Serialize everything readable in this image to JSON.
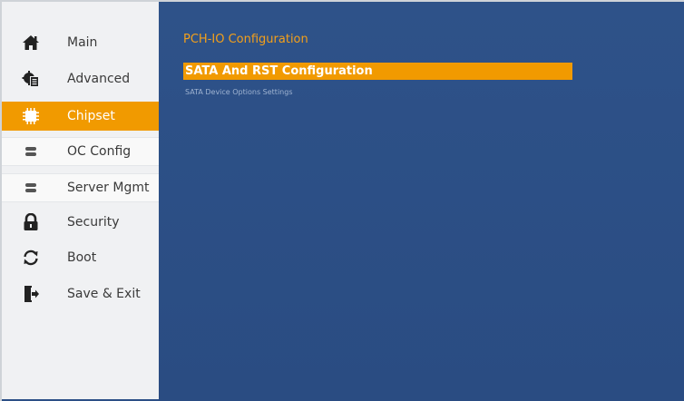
{
  "sidebar": {
    "items": [
      {
        "label": "Main",
        "icon": "home-icon"
      },
      {
        "label": "Advanced",
        "icon": "gear-clipboard-icon"
      },
      {
        "label": "Chipset",
        "icon": "chip-icon"
      },
      {
        "label": "OC Config",
        "icon": "server-icon"
      },
      {
        "label": "Server Mgmt",
        "icon": "server-icon"
      },
      {
        "label": "Security",
        "icon": "lock-icon"
      },
      {
        "label": "Boot",
        "icon": "refresh-icon"
      },
      {
        "label": "Save & Exit",
        "icon": "exit-door-icon"
      }
    ],
    "active_index": 2
  },
  "main": {
    "section_title": "PCH-IO Configuration",
    "menu_items": [
      {
        "label": "SATA And RST Configuration",
        "selected": true
      }
    ],
    "help_text": "SATA Device Options Settings"
  },
  "colors": {
    "accent": "#f19a00",
    "main_bg": "#2c4f86",
    "sidebar_bg": "#f0f1f3",
    "title_text": "#f4a01a"
  }
}
